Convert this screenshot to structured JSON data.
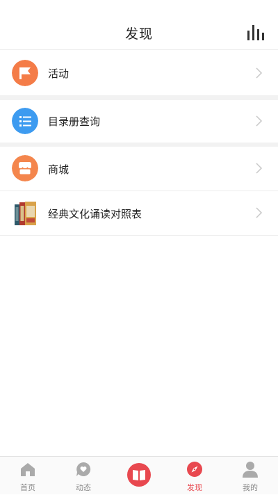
{
  "header": {
    "title": "发现",
    "icon": "bar-chart-icon"
  },
  "items": [
    {
      "label": "活动",
      "icon": "flag-icon",
      "color": "#f47c48"
    },
    {
      "label": "目录册查询",
      "icon": "list-icon",
      "color": "#3d9bf0"
    },
    {
      "label": "商城",
      "icon": "storefront-icon",
      "color": "#f4864d"
    },
    {
      "label": "经典文化诵读对照表",
      "icon": "book-stack-thumbnail"
    }
  ],
  "tabs": [
    {
      "label": "首页",
      "icon": "home-icon"
    },
    {
      "label": "动态",
      "icon": "chat-heart-icon"
    },
    {
      "label": "",
      "icon": "open-book-icon"
    },
    {
      "label": "发现",
      "icon": "compass-icon",
      "active": true
    },
    {
      "label": "我的",
      "icon": "user-icon"
    }
  ],
  "colors": {
    "accent": "#e8484f",
    "inactive": "#aaaaaa"
  }
}
